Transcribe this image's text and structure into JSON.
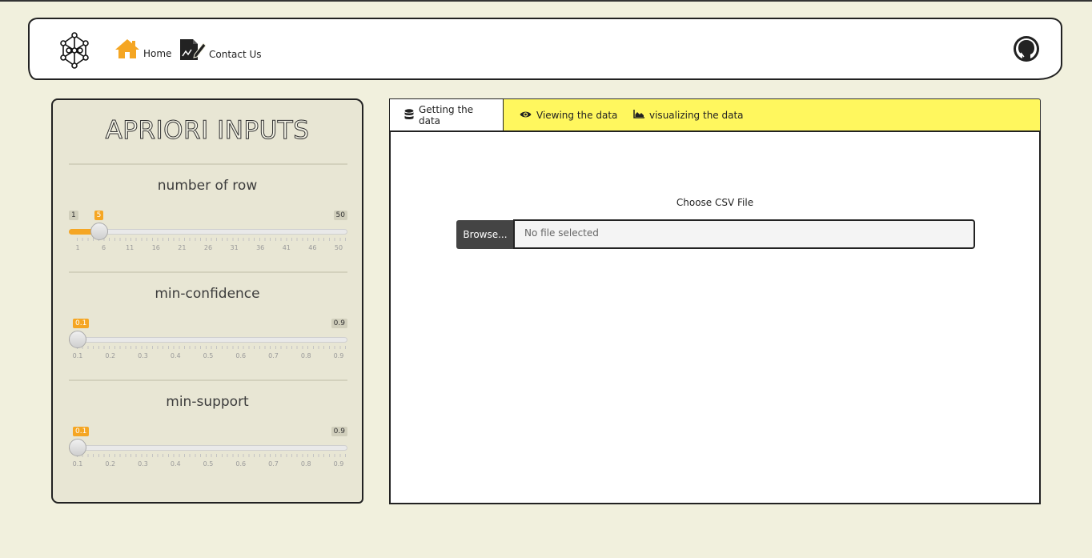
{
  "nav": {
    "home_label": "Home",
    "contact_label": "Contact Us"
  },
  "sidebar": {
    "title": "APRIORI INPUTS",
    "sliders": [
      {
        "label": "number of row",
        "min_label": "1",
        "max_label": "50",
        "current_label": "5",
        "fraction": 0.0816,
        "ticks": [
          "1",
          "6",
          "11",
          "16",
          "21",
          "26",
          "31",
          "36",
          "41",
          "46",
          "50"
        ]
      },
      {
        "label": "min-confidence",
        "min_label": "",
        "max_label": "0.9",
        "current_label": "0.1",
        "fraction": 0.0,
        "ticks": [
          "0.1",
          "0.2",
          "0.3",
          "0.4",
          "0.5",
          "0.6",
          "0.7",
          "0.8",
          "0.9"
        ]
      },
      {
        "label": "min-support",
        "min_label": "",
        "max_label": "0.9",
        "current_label": "0.1",
        "fraction": 0.0,
        "ticks": [
          "0.1",
          "0.2",
          "0.3",
          "0.4",
          "0.5",
          "0.6",
          "0.7",
          "0.8",
          "0.9"
        ]
      }
    ]
  },
  "tabs": [
    {
      "label": "Getting the data",
      "icon": "database-icon",
      "active": true
    },
    {
      "label": "Viewing the data",
      "icon": "eye-icon",
      "active": false
    },
    {
      "label": "visualizing the data",
      "icon": "area-chart-icon",
      "active": false
    }
  ],
  "file_upload": {
    "label": "Choose CSV File",
    "button_label": "Browse...",
    "placeholder": "No file selected"
  },
  "colors": {
    "background": "#f1f0dd",
    "accent_orange": "#f5a623",
    "tab_bar_yellow": "#fff75e",
    "sidebar_bg": "#e8e6d4"
  }
}
